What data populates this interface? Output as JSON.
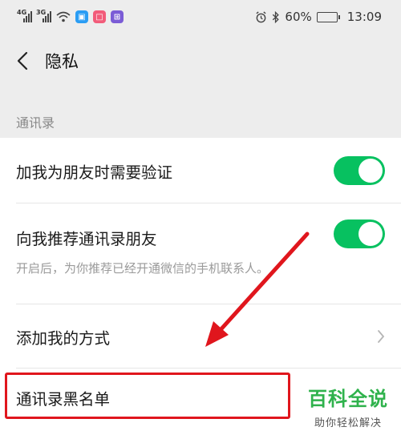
{
  "status_bar": {
    "signal1": "4G",
    "signal2": "3G",
    "battery": "60%",
    "time": "13:09"
  },
  "header": {
    "title": "隐私"
  },
  "section": {
    "label": "通讯录"
  },
  "rows": {
    "verify": {
      "label": "加我为朋友时需要验证",
      "enabled": true
    },
    "recommend": {
      "label": "向我推荐通讯录朋友",
      "enabled": true,
      "hint": "开启后，为你推荐已经开通微信的手机联系人。"
    },
    "add_methods": {
      "label": "添加我的方式"
    },
    "blacklist": {
      "label": "通讯录黑名单"
    }
  },
  "watermark": {
    "main": "百科全说",
    "sub": "助你轻松解决"
  },
  "colors": {
    "toggle_on": "#07c160",
    "annotation_red": "#e0161d",
    "watermark_green": "#2fb24c"
  }
}
